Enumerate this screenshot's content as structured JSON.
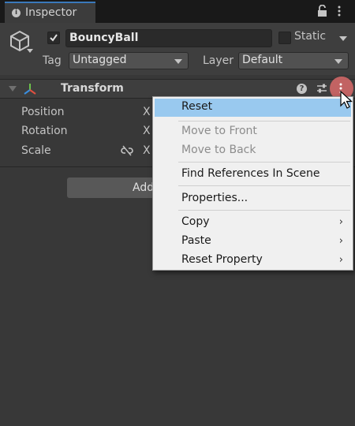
{
  "tab": {
    "label": "Inspector",
    "icon": "info-icon"
  },
  "object": {
    "active": true,
    "name": "BouncyBall",
    "static_label": "Static",
    "static_checked": false,
    "tag_label": "Tag",
    "tag_value": "Untagged",
    "layer_label": "Layer",
    "layer_value": "Default"
  },
  "component": {
    "title": "Transform",
    "rows": [
      {
        "label": "Position",
        "axis": "X"
      },
      {
        "label": "Rotation",
        "axis": "X"
      },
      {
        "label": "Scale",
        "axis": "X"
      }
    ]
  },
  "add_component_label": "Add",
  "context_menu": {
    "items": [
      {
        "label": "Reset",
        "state": "highlighted"
      },
      {
        "label": "Move to Front",
        "state": "disabled"
      },
      {
        "label": "Move to Back",
        "state": "disabled"
      },
      {
        "label": "Find References In Scene",
        "state": "enabled"
      },
      {
        "label": "Properties...",
        "state": "enabled"
      },
      {
        "label": "Copy",
        "state": "enabled",
        "submenu": true
      },
      {
        "label": "Paste",
        "state": "enabled",
        "submenu": true
      },
      {
        "label": "Reset Property",
        "state": "enabled",
        "submenu": true
      }
    ]
  },
  "colors": {
    "highlight": "#99c9ef",
    "accent_tab": "#3a79bb",
    "menu_button_glow": "#d96a6a"
  }
}
